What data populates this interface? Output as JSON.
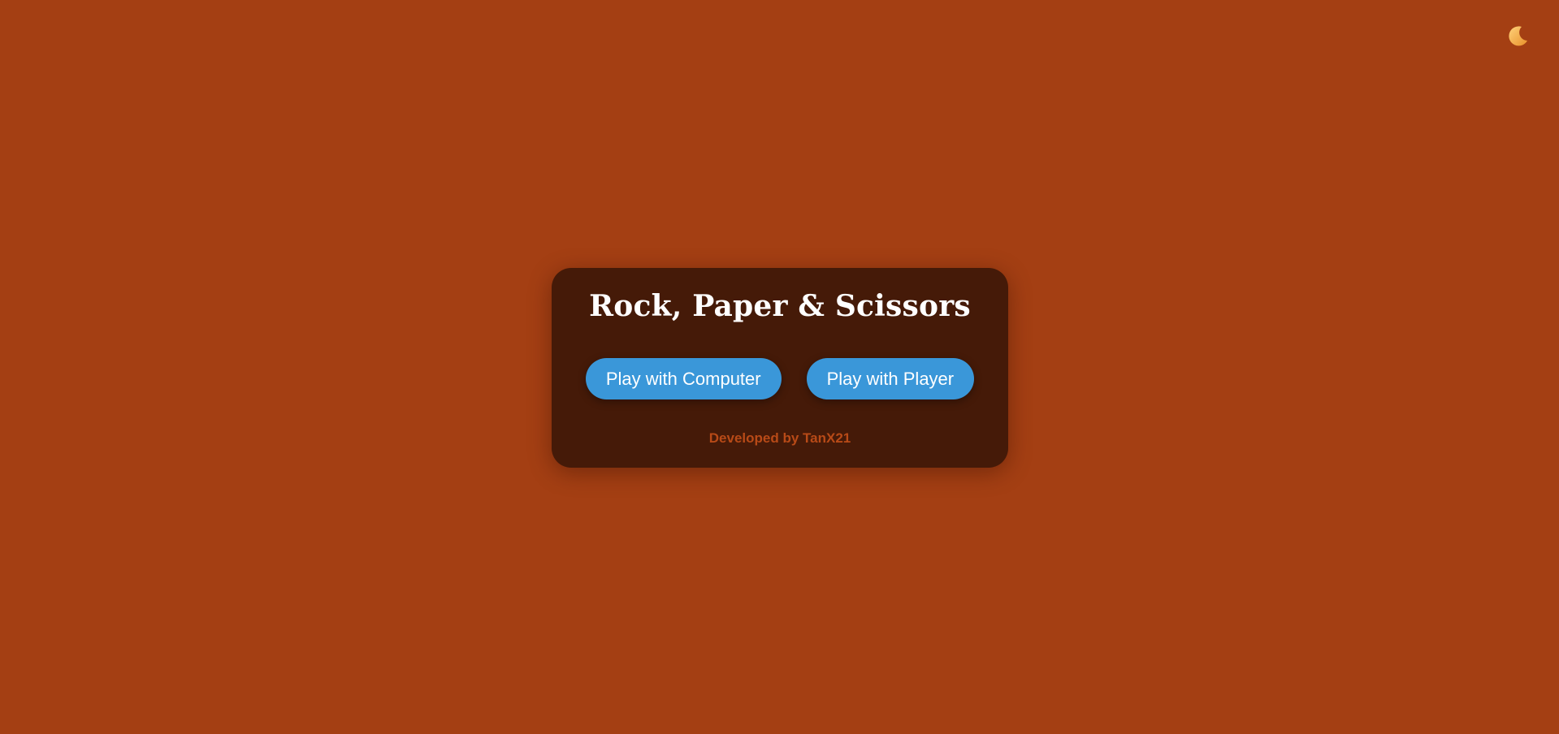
{
  "theme_toggle": {
    "icon": "moon-icon",
    "color": "#f5b04a"
  },
  "colors": {
    "background": "#a43f13",
    "card": "#451a08",
    "button": "#3a97d9",
    "credit": "#b84a17"
  },
  "card": {
    "title": "Rock, Paper & Scissors",
    "buttons": {
      "computer": "Play with Computer",
      "player": "Play with Player"
    },
    "credit": "Developed by TanX21"
  }
}
